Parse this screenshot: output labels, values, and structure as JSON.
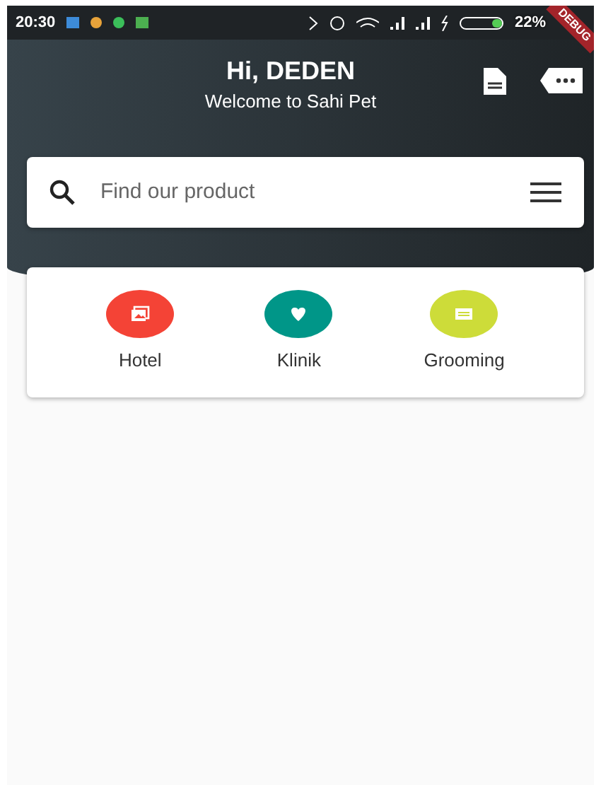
{
  "status_bar": {
    "time": "20:30",
    "battery": "22%"
  },
  "debug_banner": "DEBUG",
  "header": {
    "greeting": "Hi, DEDEN",
    "subtitle": "Welcome to Sahi Pet"
  },
  "search": {
    "placeholder": "Find our product"
  },
  "services": [
    {
      "label": "Hotel",
      "color": "#f44336",
      "kind": "photos"
    },
    {
      "label": "Klinik",
      "color": "#009688",
      "kind": "heart"
    },
    {
      "label": "Grooming",
      "color": "#cddc39",
      "kind": "card"
    }
  ]
}
